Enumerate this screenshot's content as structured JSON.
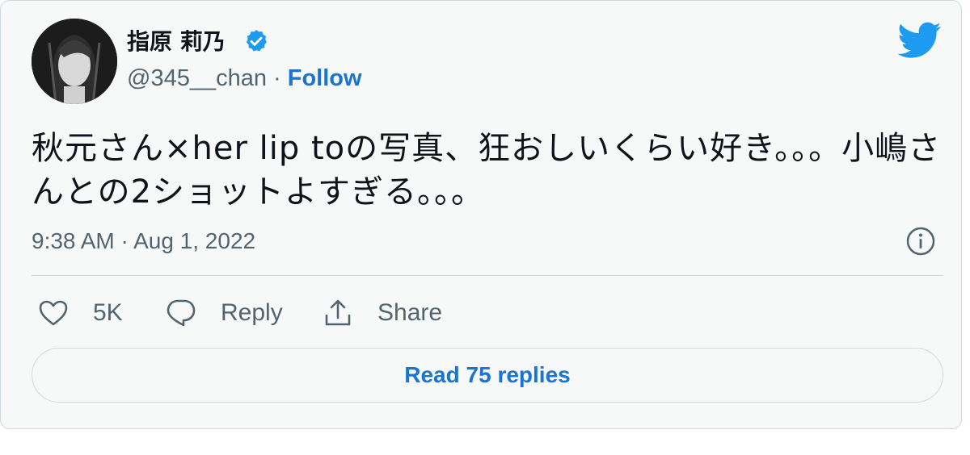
{
  "author": {
    "name": "指原 莉乃",
    "handle": "@345__chan",
    "separator": " · ",
    "follow_label": "Follow",
    "verified": true
  },
  "tweet": {
    "text": "秋元さん×her lip toの写真、狂おしいくらい好き。。。小嶋さんとの2ショットよすぎる。。。",
    "timestamp": "9:38 AM · Aug 1, 2022"
  },
  "actions": {
    "like_count": "5K",
    "reply_label": "Reply",
    "share_label": "Share"
  },
  "footer": {
    "read_replies_label": "Read 75 replies"
  },
  "colors": {
    "brand": "#1d9bf0",
    "link": "#1b74d3",
    "text_primary": "#0f1419",
    "text_secondary": "#536471",
    "border": "#cfd9de",
    "card_background": "#f7f9f9"
  },
  "icons": {
    "brand": "twitter-bird-icon",
    "verified": "verified-badge-icon",
    "info": "info-icon",
    "like": "heart-icon",
    "reply": "reply-bubble-icon",
    "share": "share-icon"
  }
}
